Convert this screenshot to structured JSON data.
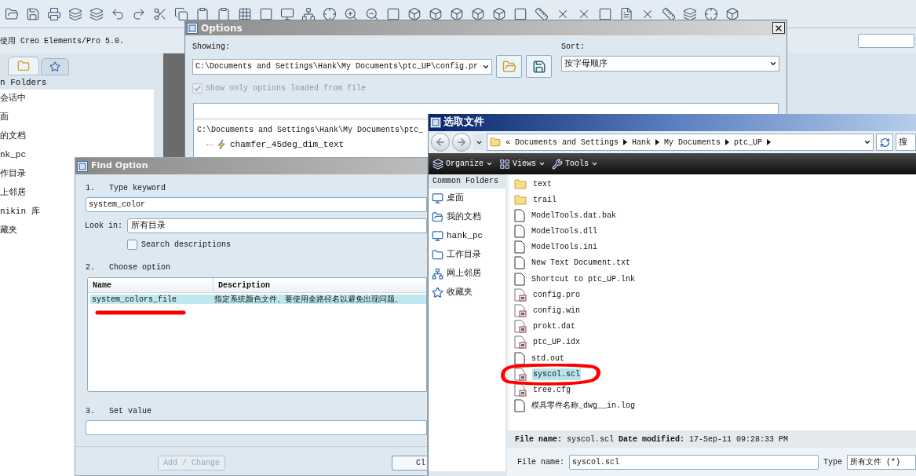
{
  "app": {
    "status_text": "使用 Creo Elements/Pro 5.0.",
    "folder_header": "n Folders",
    "folders": [
      "会话中",
      "面",
      "的文档",
      "nk_pc",
      "作目录",
      "上邻居",
      "nikin 库",
      "藏夹"
    ]
  },
  "options": {
    "title": "Options",
    "showing_label": "Showing:",
    "showing_value": "C:\\Documents and Settings\\Hank\\My Documents\\ptc_UP\\config.pr",
    "sort_label": "Sort:",
    "sort_value": "按字母顺序",
    "loaded_only": {
      "label": "Show only options loaded from file",
      "checked": true,
      "disabled": true
    },
    "tree_root": "C:\\Documents and Settings\\Hank\\My Documents\\ptc_",
    "tree_items": [
      "chamfer_45deg_dim_text"
    ]
  },
  "find_option": {
    "title": "Find Option",
    "step1": "1.   Type keyword",
    "keyword": "system_color",
    "look_in_label": "Look in:",
    "look_in_value": "所有目录",
    "search_descriptions": {
      "label": "Search descriptions",
      "checked": false
    },
    "step2": "2.   Choose option",
    "columns": [
      "Name",
      "Description"
    ],
    "rows": [
      {
        "name": "system_colors_file",
        "description": "指定系统颜色文件。要使用全路径名以避免出现问题。",
        "selected": true
      }
    ],
    "step3": "3.   Set value",
    "add_button": {
      "label": "Add / Change",
      "disabled": true
    },
    "close_button": "Cl"
  },
  "file_dialog": {
    "title": "选取文件",
    "breadcrumb": [
      "«",
      "Documents and Settings",
      "Hank",
      "My Documents",
      "ptc_UP"
    ],
    "search_text": "搜",
    "toolbar": [
      "Organize",
      "Views",
      "Tools"
    ],
    "common_header": "Common Folders",
    "common_folders": [
      "桌面",
      "我的文档",
      "hank_pc",
      "工作目录",
      "网上邻居",
      "收藏夹"
    ],
    "files": [
      {
        "name": "text",
        "kind": "folder",
        "selected": false
      },
      {
        "name": "trail",
        "kind": "folder",
        "selected": false
      },
      {
        "name": "ModelTools.dat.bak",
        "kind": "file",
        "selected": false
      },
      {
        "name": "ModelTools.dll",
        "kind": "file",
        "selected": false
      },
      {
        "name": "ModelTools.ini",
        "kind": "file",
        "selected": false
      },
      {
        "name": "New Text Document.txt",
        "kind": "file",
        "selected": false
      },
      {
        "name": "Shortcut to ptc_UP.lnk",
        "kind": "file",
        "selected": false
      },
      {
        "name": "config.pro",
        "kind": "config",
        "selected": false
      },
      {
        "name": "config.win",
        "kind": "config",
        "selected": false
      },
      {
        "name": "prokt.dat",
        "kind": "config",
        "selected": false
      },
      {
        "name": "ptc_UP.idx",
        "kind": "config",
        "selected": false
      },
      {
        "name": "std.out",
        "kind": "file",
        "selected": false
      },
      {
        "name": "syscol.scl",
        "kind": "config",
        "selected": true
      },
      {
        "name": "tree.cfg",
        "kind": "config",
        "selected": false
      },
      {
        "name": "模具零件名称_dwg__in.log",
        "kind": "file",
        "selected": false
      }
    ],
    "details": {
      "name_label": "File name:",
      "name_value": "syscol.scl",
      "date_label": "Date modified:",
      "date_value": "17-Sep-11 09:28:33 PM"
    },
    "filename_label": "File name:",
    "filename_value": "syscol.scl",
    "type_label": "Type",
    "type_value": "所有文件 (*)"
  }
}
